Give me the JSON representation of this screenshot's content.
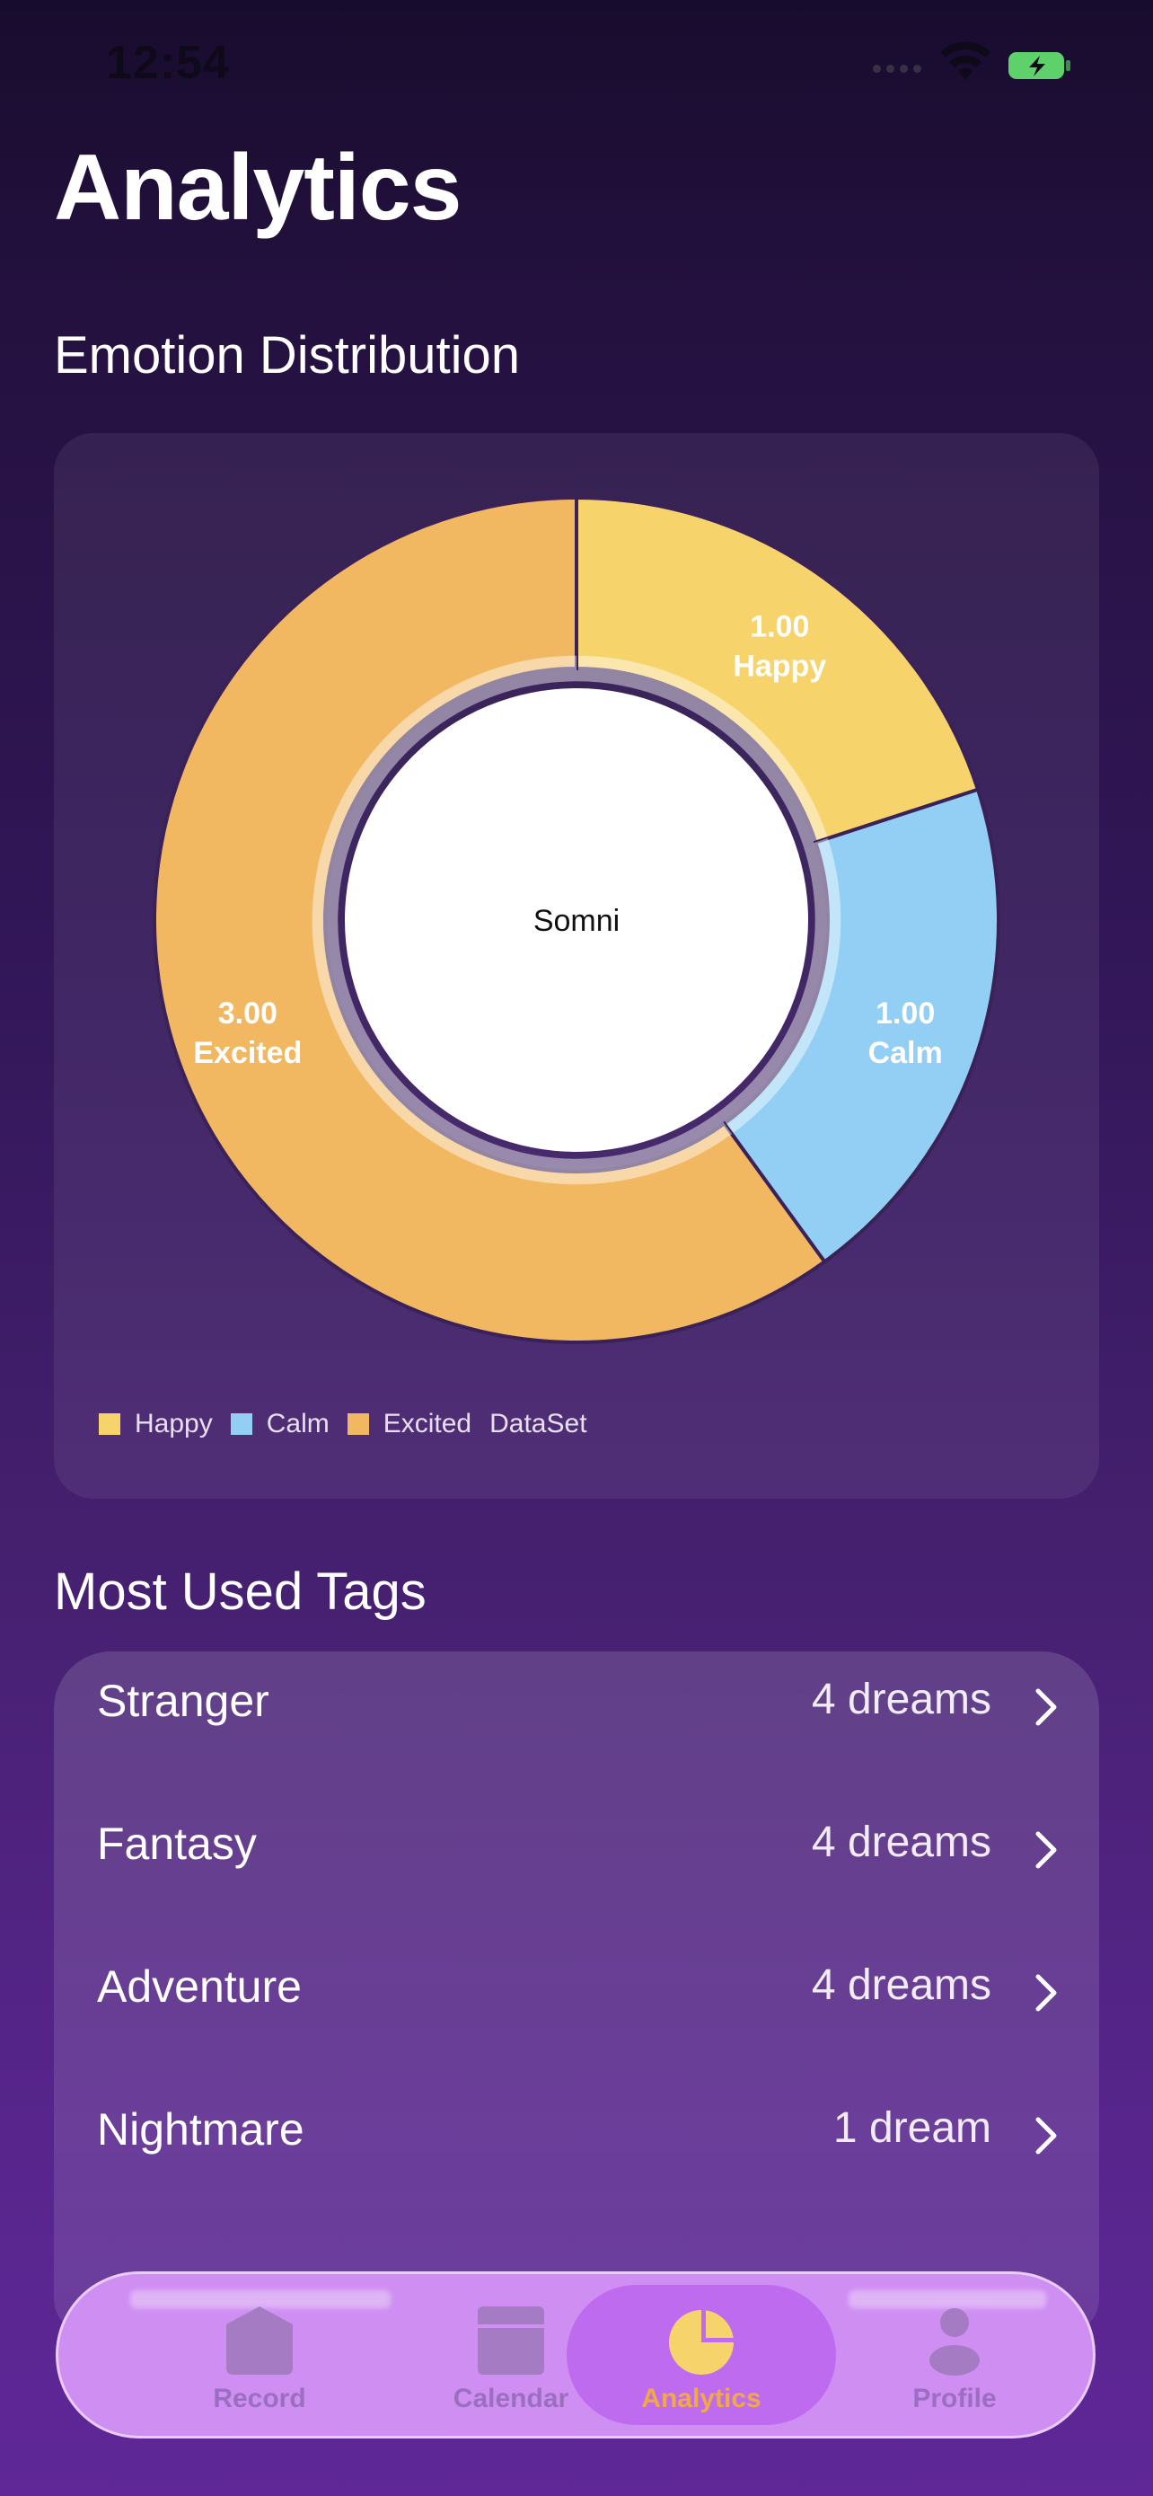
{
  "status_bar": {
    "time": "12:54"
  },
  "page": {
    "title": "Analytics"
  },
  "emotion_section": {
    "title": "Emotion Distribution"
  },
  "chart_data": {
    "type": "pie",
    "variant": "donut",
    "center_text": "Somni",
    "slices": [
      {
        "label": "Happy",
        "value": 1.0,
        "value_label": "1.00",
        "color": "#f7d46b"
      },
      {
        "label": "Calm",
        "value": 1.0,
        "value_label": "1.00",
        "color": "#93cff5"
      },
      {
        "label": "Excited",
        "value": 3.0,
        "value_label": "3.00",
        "color": "#f2b861"
      }
    ],
    "legend": {
      "entries": [
        "Happy",
        "Calm",
        "Excited"
      ],
      "dataset_label": "DataSet",
      "position": "bottom-left"
    }
  },
  "tags_section": {
    "title": "Most Used Tags",
    "items": [
      {
        "name": "Stranger",
        "count": "4 dreams"
      },
      {
        "name": "Fantasy",
        "count": "4 dreams"
      },
      {
        "name": "Adventure",
        "count": "4 dreams"
      },
      {
        "name": "Nightmare",
        "count": "1 dream"
      }
    ]
  },
  "tab_bar": {
    "tabs": [
      {
        "label": "Record",
        "icon": "record-icon"
      },
      {
        "label": "Calendar",
        "icon": "calendar-icon"
      },
      {
        "label": "Analytics",
        "icon": "analytics-icon",
        "active": true
      },
      {
        "label": "Profile",
        "icon": "profile-icon"
      }
    ],
    "active_color": "#f1a946"
  }
}
